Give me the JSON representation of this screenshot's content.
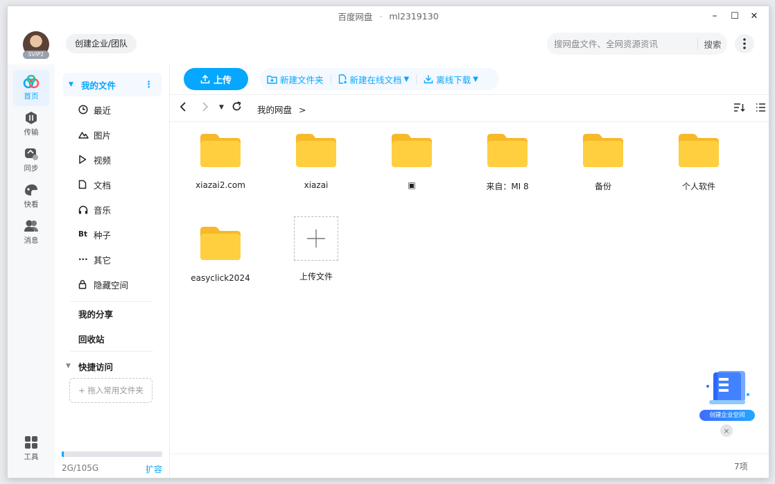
{
  "window": {
    "title": "百度网盘",
    "separator": "·",
    "user": "ml2319130",
    "controls": {
      "minimize": "–",
      "maximize": "☐",
      "close": "✕"
    }
  },
  "header": {
    "vip_label": "SVIP1",
    "team_button": "创建企业/团队",
    "search": {
      "placeholder": "搜网盘文件、全网资源资讯",
      "button": "搜索"
    },
    "more_icon": "more-vertical-icon"
  },
  "leftnav": {
    "items": [
      {
        "label": "首页",
        "icon": "home-icon",
        "active": true
      },
      {
        "label": "传输",
        "icon": "transfer-icon",
        "active": false
      },
      {
        "label": "同步",
        "icon": "sync-icon",
        "active": false
      },
      {
        "label": "快看",
        "icon": "quick-view-icon",
        "active": false
      },
      {
        "label": "消息",
        "icon": "message-icon",
        "active": false
      }
    ],
    "tools_label": "工具"
  },
  "sidebar": {
    "my_files": "我的文件",
    "items": [
      {
        "label": "最近",
        "icon": "clock-icon"
      },
      {
        "label": "图片",
        "icon": "image-icon"
      },
      {
        "label": "视频",
        "icon": "play-icon"
      },
      {
        "label": "文档",
        "icon": "document-icon"
      },
      {
        "label": "音乐",
        "icon": "headphones-icon"
      },
      {
        "label": "种子",
        "icon": "bt-icon"
      },
      {
        "label": "其它",
        "icon": "ellipsis-icon"
      },
      {
        "label": "隐藏空间",
        "icon": "lock-icon"
      }
    ],
    "my_share": "我的分享",
    "recycle": "回收站",
    "quick_access": "快捷访问",
    "drop_hint": "+ 拖入常用文件夹",
    "storage": {
      "text": "2G/105G",
      "used_fraction": 0.019,
      "expand": "扩容"
    }
  },
  "toolbar": {
    "upload": "上传",
    "new_folder": "新建文件夹",
    "new_online_doc": "新建在线文档",
    "offline_download": "离线下载"
  },
  "path": {
    "crumb": "我的网盘",
    "crumb_arrow": ">"
  },
  "files": [
    {
      "name": "xiazai2.com",
      "type": "folder"
    },
    {
      "name": "xiazai",
      "type": "folder"
    },
    {
      "name": "▣",
      "type": "folder"
    },
    {
      "name": "来自：MI 8",
      "type": "folder"
    },
    {
      "name": "备份",
      "type": "folder"
    },
    {
      "name": "个人软件",
      "type": "folder"
    },
    {
      "name": "easyclick2024",
      "type": "folder"
    },
    {
      "name": "上传文件",
      "type": "upload"
    }
  ],
  "footer": {
    "count": "7项"
  },
  "promo": {
    "label": "创建企业空间",
    "close": "×"
  },
  "colors": {
    "accent": "#06a7ff",
    "folder": "#ffcf3f",
    "folder_tab": "#f7b928"
  }
}
